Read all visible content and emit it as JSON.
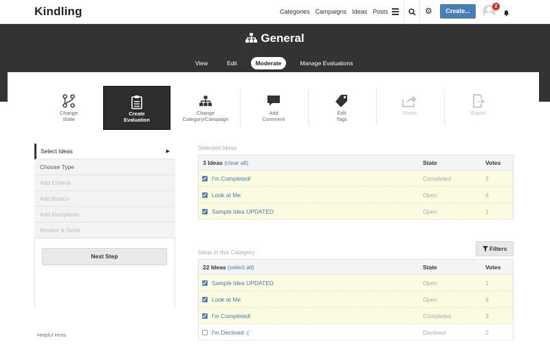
{
  "app": {
    "name": "Kindling"
  },
  "topnav": {
    "links": [
      "Categories",
      "Campaigns",
      "Ideas",
      "Posts"
    ],
    "create_label": "Create...",
    "notification_count": "2"
  },
  "header": {
    "title": "General",
    "tabs": [
      {
        "label": "View",
        "active": false
      },
      {
        "label": "Edit",
        "active": false
      },
      {
        "label": "Moderate",
        "active": true
      },
      {
        "label": "Manage Evaluations",
        "active": false
      }
    ]
  },
  "toolbar": {
    "actions": [
      {
        "label_line1": "Change",
        "label_line2": "State",
        "icon": "change-state-icon",
        "state": "enabled"
      },
      {
        "label_line1": "Create",
        "label_line2": "Evaluation",
        "icon": "clipboard-icon",
        "state": "active"
      },
      {
        "label_line1": "Change",
        "label_line2": "Category/Campaign",
        "icon": "hierarchy-icon",
        "state": "enabled"
      },
      {
        "label_line1": "Add",
        "label_line2": "Comment",
        "icon": "comment-icon",
        "state": "enabled"
      },
      {
        "label_line1": "Edit",
        "label_line2": "Tags",
        "icon": "tag-icon",
        "state": "enabled"
      },
      {
        "label_line1": "Share",
        "label_line2": "",
        "icon": "share-icon",
        "state": "disabled"
      },
      {
        "label_line1": "Export",
        "label_line2": "",
        "icon": "export-icon",
        "state": "disabled"
      }
    ]
  },
  "wizard": {
    "steps": [
      {
        "label": "Select Ideas",
        "state": "active"
      },
      {
        "label": "Choose Type",
        "state": "enabled"
      },
      {
        "label": "Add Criteria",
        "state": "disabled"
      },
      {
        "label": "Add Basics",
        "state": "disabled"
      },
      {
        "label": "Add Recipients",
        "state": "disabled"
      },
      {
        "label": "Review & Send",
        "state": "disabled"
      }
    ],
    "next_label": "Next Step",
    "hints_label": "Helpful Hints"
  },
  "selected": {
    "section_label": "Selected Ideas",
    "count_label": "3 Ideas",
    "action_label": "(clear all)",
    "col_state": "State",
    "col_votes": "Votes",
    "rows": [
      {
        "title": "I'm Completed!",
        "state": "Completed",
        "votes": "3",
        "checked": true
      },
      {
        "title": "Look at Me",
        "state": "Open",
        "votes": "4",
        "checked": true
      },
      {
        "title": "Sample Idea UPDATED",
        "state": "Open",
        "votes": "1",
        "checked": true
      }
    ]
  },
  "category": {
    "section_label": "Ideas in this Category",
    "filters_label": "Filters",
    "count_label": "22 Ideas",
    "action_label": "(select all)",
    "col_state": "State",
    "col_votes": "Votes",
    "rows": [
      {
        "title": "Sample Idea UPDATED",
        "state": "Open",
        "votes": "1",
        "checked": true
      },
      {
        "title": "Look at Me",
        "state": "Open",
        "votes": "4",
        "checked": true
      },
      {
        "title": "I'm Completed!",
        "state": "Completed",
        "votes": "3",
        "checked": true
      },
      {
        "title": "I'm Declined :(",
        "state": "Declined",
        "votes": "2",
        "checked": false
      }
    ]
  }
}
